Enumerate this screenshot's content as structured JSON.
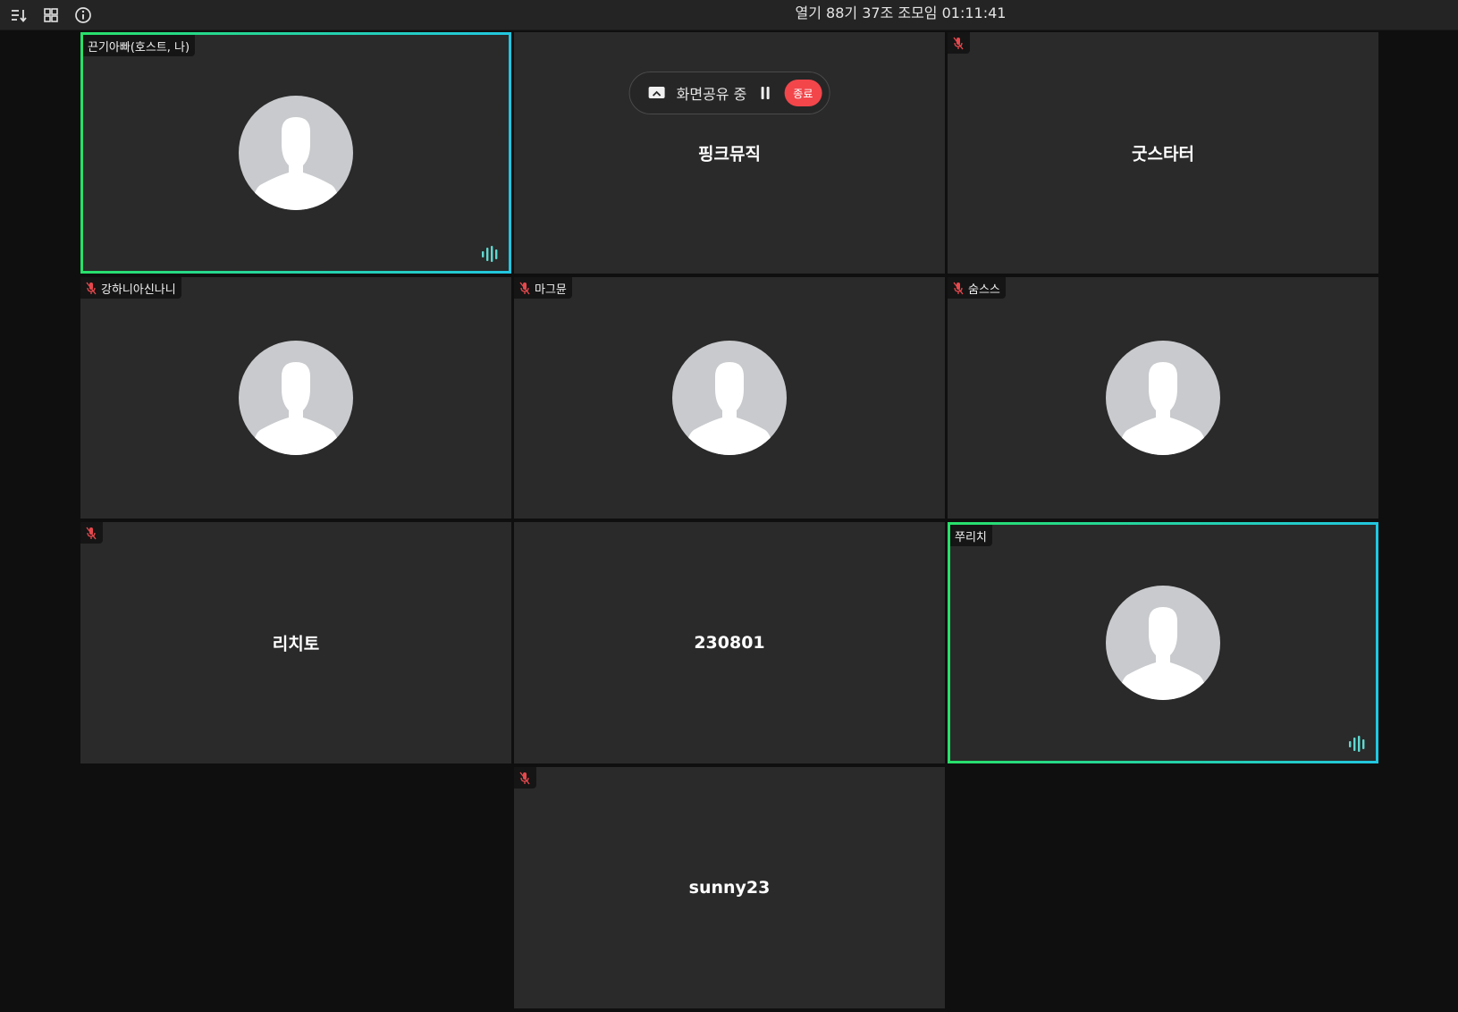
{
  "toolbar": {
    "sort_icon": "sort-list-icon",
    "grid_icon": "grid-view-icon",
    "info_icon": "info-icon"
  },
  "meeting": {
    "title": "열기 88기 37조 조모임 01:11:41"
  },
  "screen_share": {
    "label": "화면공유 중",
    "stop_label": "종료"
  },
  "tiles": [
    {
      "name": "끈기아빠(호스트, 나)",
      "center_name": "",
      "muted": false,
      "speaking": true,
      "video": "avatar"
    },
    {
      "name": "",
      "center_name": "핑크뮤직",
      "muted": false,
      "speaking": false,
      "video": "off"
    },
    {
      "name": "",
      "center_name": "굿스타터",
      "muted": true,
      "speaking": false,
      "video": "off"
    },
    {
      "name": "강하니아신나니",
      "center_name": "",
      "muted": true,
      "speaking": false,
      "video": "avatar"
    },
    {
      "name": "마그뮨",
      "center_name": "",
      "muted": true,
      "speaking": false,
      "video": "avatar"
    },
    {
      "name": "숨스스",
      "center_name": "",
      "muted": true,
      "speaking": false,
      "video": "avatar"
    },
    {
      "name": "",
      "center_name": "리치토",
      "muted": true,
      "speaking": false,
      "video": "off"
    },
    {
      "name": "",
      "center_name": "230801",
      "muted": false,
      "speaking": false,
      "video": "off"
    },
    {
      "name": "쭈리치",
      "center_name": "",
      "muted": false,
      "speaking": true,
      "video": "avatar"
    },
    {
      "name": "",
      "center_name": "sunny23",
      "muted": true,
      "speaking": false,
      "video": "off"
    }
  ],
  "colors": {
    "speaking_gradient_start": "#28e06a",
    "speaking_gradient_end": "#22c6e0",
    "muted_icon": "#e5484d",
    "stop_button": "#f2464b",
    "tile_bg": "#2a2a2a",
    "avatar_bg": "#c8cacd"
  }
}
